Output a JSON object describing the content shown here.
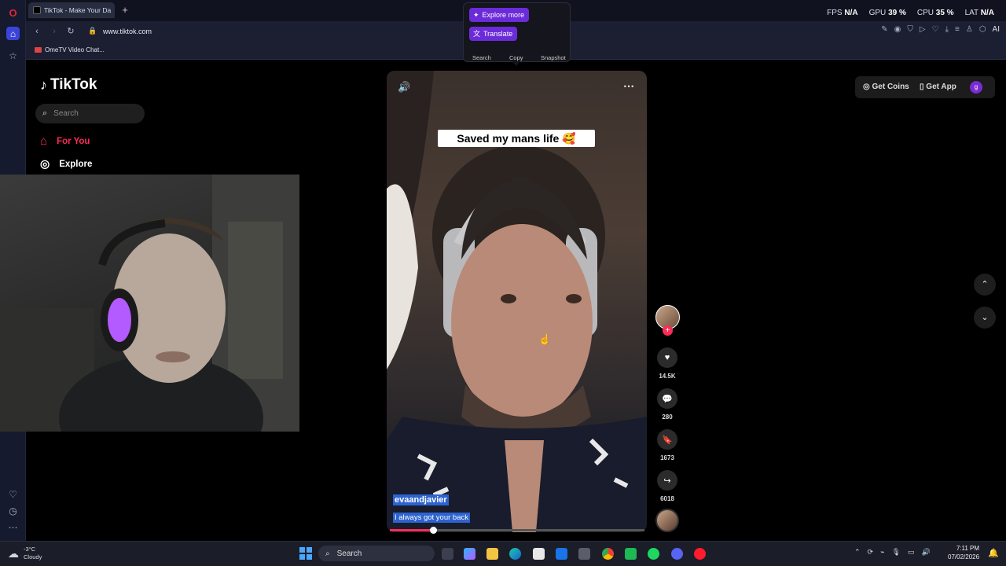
{
  "browser": {
    "tab_title": "TikTok - Make Your Da",
    "url": "www.tiktok.com",
    "bookmark": "OmeTV Video Chat...",
    "stats": {
      "fps_label": "FPS",
      "fps_value": "N/A",
      "gpu_label": "GPU",
      "gpu_value": "39 %",
      "cpu_label": "CPU",
      "cpu_value": "35 %",
      "lat_label": "LAT",
      "lat_value": "N/A"
    },
    "toolbar_right_label": "AI"
  },
  "popup": {
    "explore_more": "Explore more",
    "translate": "Translate",
    "search": "Search",
    "copy": "Copy",
    "snapshot": "Snapshot"
  },
  "tiktok": {
    "logo": "TikTok",
    "search_placeholder": "Search",
    "nav": {
      "for_you": "For You",
      "explore": "Explore"
    },
    "get_coins": "Get Coins",
    "get_app": "Get App",
    "profile_initial": "g"
  },
  "video": {
    "caption": "Saved my mans life 🥰",
    "username": "evaandjavier",
    "description": "I always got your back",
    "progress": 0.17,
    "likes": "14.5K",
    "comments": "280",
    "saves": "1673",
    "shares": "6018"
  },
  "taskbar": {
    "temperature": "-3°C",
    "weather": "Cloudy",
    "search": "Search",
    "time": "7:11 PM",
    "date": "07/02/2026"
  }
}
